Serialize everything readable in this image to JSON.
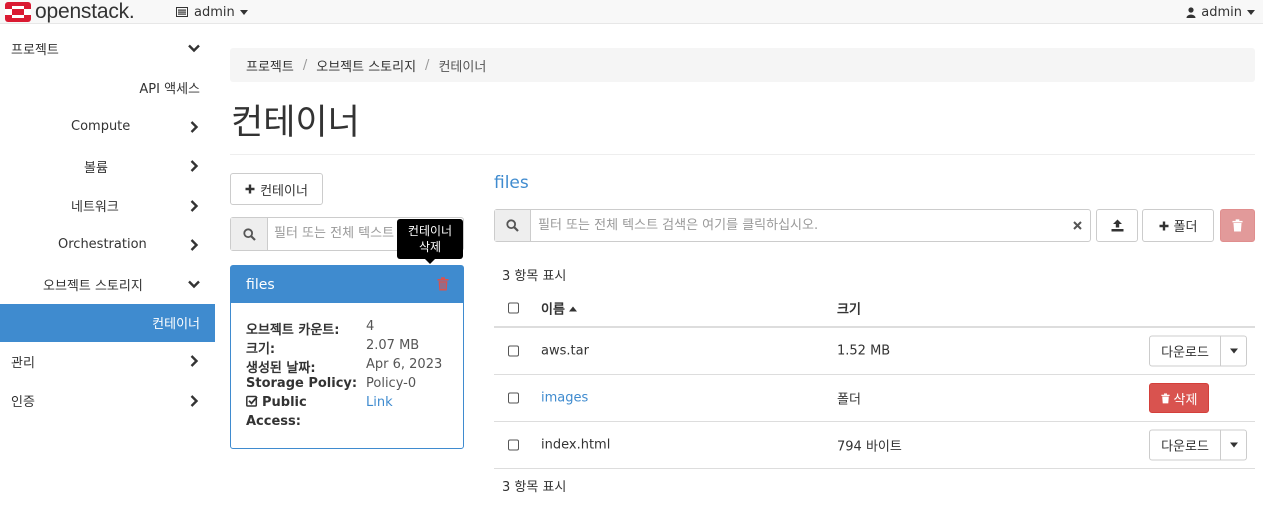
{
  "brand": {
    "name": "openstack.",
    "color": "#da1a32"
  },
  "topbar": {
    "project_label": "admin",
    "user_label": "admin"
  },
  "sidebar": {
    "items": [
      {
        "label": "프로젝트",
        "chevron": "down"
      },
      {
        "label": "API 액세스",
        "chevron": "none"
      },
      {
        "label": "Compute",
        "chevron": "right"
      },
      {
        "label": "볼륨",
        "chevron": "right"
      },
      {
        "label": "네트워크",
        "chevron": "right"
      },
      {
        "label": "Orchestration",
        "chevron": "right"
      },
      {
        "label": "오브젝트 스토리지",
        "chevron": "down"
      },
      {
        "label": "컨테이너",
        "chevron": "none",
        "active": true
      },
      {
        "label": "관리",
        "chevron": "right"
      },
      {
        "label": "인증",
        "chevron": "right"
      }
    ],
    "active_color": "#3f8bcf"
  },
  "breadcrumb": {
    "items": [
      "프로젝트",
      "오브젝트 스토리지",
      "컨테이너"
    ],
    "separator": "/"
  },
  "page": {
    "title": "컨테이너"
  },
  "left_panel": {
    "add_container_label": "컨테이너",
    "filter_placeholder": "필터 또는 전체 텍스트",
    "tooltip_line1": "컨테이너",
    "tooltip_line2": "삭제",
    "container_card": {
      "name": "files",
      "rows": [
        {
          "key": "오브젝트 카운트:",
          "value": "4"
        },
        {
          "key": "크기:",
          "value": "2.07 MB"
        },
        {
          "key": "생성된 날짜:",
          "value": "Apr 6, 2023"
        },
        {
          "key": "Storage Policy:",
          "value": "Policy-0"
        }
      ],
      "public_access_label_1": "Public",
      "public_access_label_2": "Access:",
      "public_access_value": "Link",
      "public_access_checked": true
    }
  },
  "right_panel": {
    "container_title": "files",
    "filter_placeholder": "필터 또는 전체 텍스트 검색은 여기를 클릭하십시오.",
    "folder_button_label": "폴더",
    "count_text": "3 항목 표시",
    "columns": {
      "name": "이름",
      "size": "크기"
    },
    "rows": [
      {
        "name": "aws.tar",
        "size": "1.52 MB",
        "kind": "file",
        "action": "다운로드"
      },
      {
        "name": "images",
        "size": "폴더",
        "kind": "folder",
        "action": "삭제"
      },
      {
        "name": "index.html",
        "size": "794 바이트",
        "kind": "file",
        "action": "다운로드"
      }
    ]
  },
  "icons": {
    "search": "search-icon",
    "upload": "upload-icon",
    "plus": "plus-icon",
    "trash": "trash-icon",
    "user": "user-icon",
    "project": "project-icon"
  }
}
